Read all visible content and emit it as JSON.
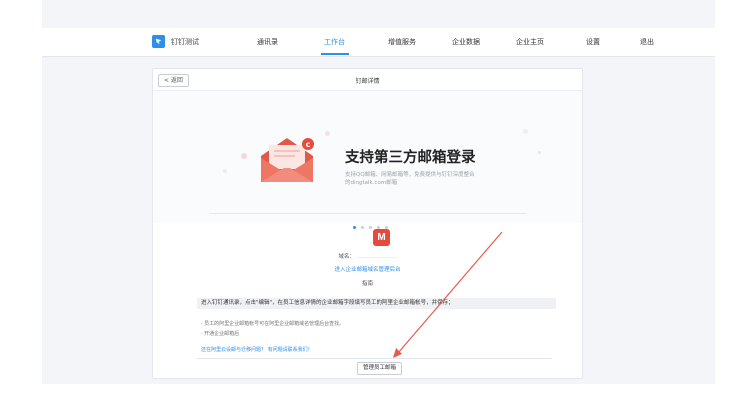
{
  "colors": {
    "accent": "#2f8fe8",
    "mail_red": "#e64a3b",
    "arrow": "#e85a4f"
  },
  "brand": {
    "name": "钉钉测试",
    "logo_icon": "dingtalk-logo-icon"
  },
  "nav": {
    "items": [
      {
        "label": "通讯录",
        "active": false
      },
      {
        "label": "工作台",
        "active": true
      },
      {
        "label": "增值服务",
        "active": false
      },
      {
        "label": "企业数据",
        "active": false
      },
      {
        "label": "企业主页",
        "active": false
      },
      {
        "label": "设置",
        "active": false
      },
      {
        "label": "退出",
        "active": false
      }
    ]
  },
  "card": {
    "back_label": "< 返回",
    "title": "钉邮详情",
    "banner": {
      "title": "支持第三方邮箱登录",
      "desc_line1": "支持QQ邮箱、网易邮箱等，免费提供与钉钉深度整合",
      "desc_line2": "的dingtalk.com邮箱",
      "envelope_icon": "envelope-icon",
      "dots_count": 5,
      "active_dot": 1
    },
    "mail_logo_letter": "M",
    "domain_label": "域名：",
    "enter_link": "进入企业邮箱域名管理后台",
    "helper": "指南",
    "notice": "进入钉钉通讯录，点击\"编辑\"，在员工信息详情的企业邮箱字段填写员工的阿里企业邮箱帐号，并保存；",
    "note1": "· 员工的阿里企业邮箱帐号可在阿里企业邮箱域名管理后台查找。",
    "note2": "· 开通企业邮箱后",
    "help_link1": "还在阿里云设邮与迁移问题？",
    "help_link2": "有问题请联系我们！",
    "manage_button": "管理员工邮箱"
  }
}
